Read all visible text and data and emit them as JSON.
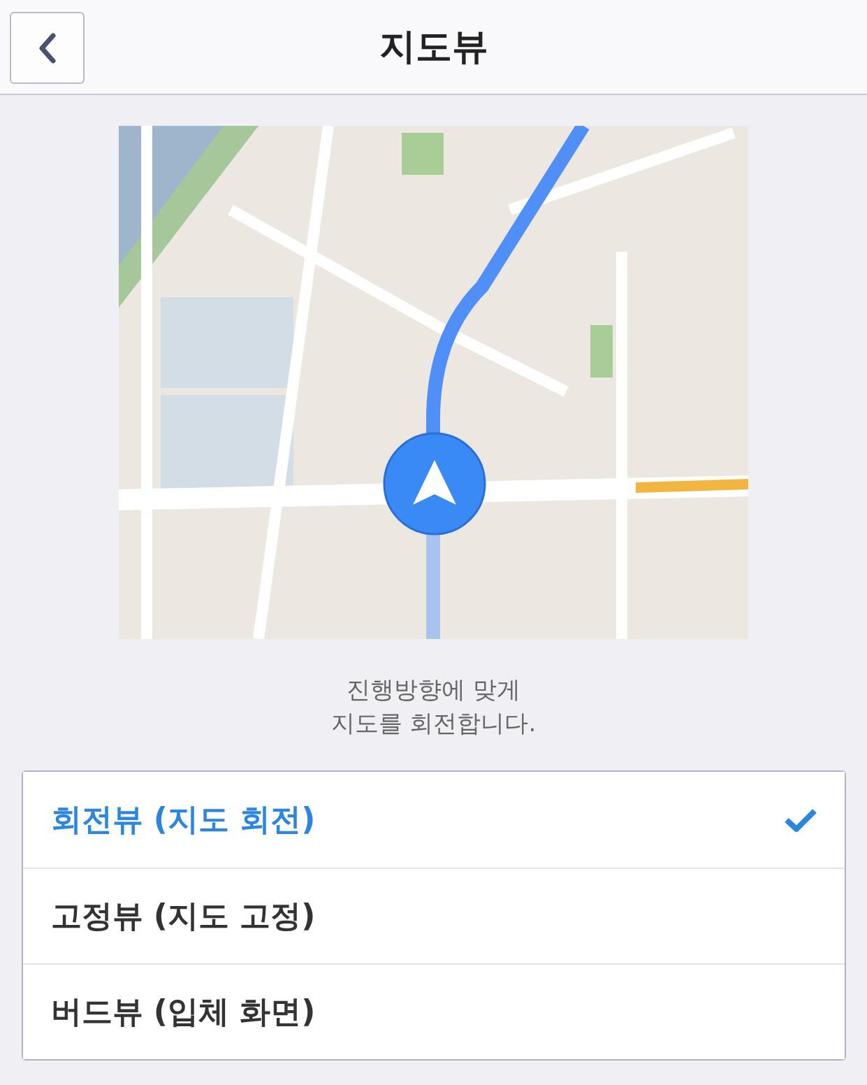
{
  "header": {
    "title": "지도뷰"
  },
  "preview": {
    "kind": "picture"
  },
  "description": [
    "진행방향에 맞게",
    "지도를 회전합니다."
  ],
  "options": [
    {
      "label": "회전뷰 (지도 회전)",
      "selected": true
    },
    {
      "label": "고정뷰 (지도 고정)",
      "selected": false
    },
    {
      "label": "버드뷰 (입체 화면)",
      "selected": false
    }
  ]
}
